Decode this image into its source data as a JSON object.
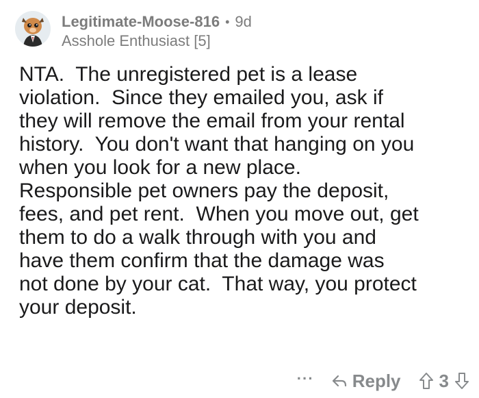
{
  "comment": {
    "username": "Legitimate-Moose-816",
    "separator": "•",
    "age": "9d",
    "flair": "Asshole Enthusiast [5]",
    "body": "NTA.  The unregistered pet is a lease\nviolation.  Since they emailed you, ask if\nthey will remove the email from your rental\nhistory.  You don't want that hanging on you\nwhen you look for a new place.\nResponsible pet owners pay the deposit,\nfees, and pet rent.  When you move out, get\nthem to do a walk through with you and\nhave them confirm that the damage was\nnot done by your cat.  That way, you protect\nyour deposit."
  },
  "actions": {
    "more_label": "···",
    "reply_label": "Reply",
    "score": "3"
  },
  "icons": {
    "avatar": "avatar-icon",
    "more": "more-icon",
    "reply": "reply-icon",
    "upvote": "upvote-icon",
    "downvote": "downvote-icon"
  },
  "colors": {
    "text": "#1a1a1b",
    "muted": "#7c7c7c",
    "action": "#878a8c"
  }
}
